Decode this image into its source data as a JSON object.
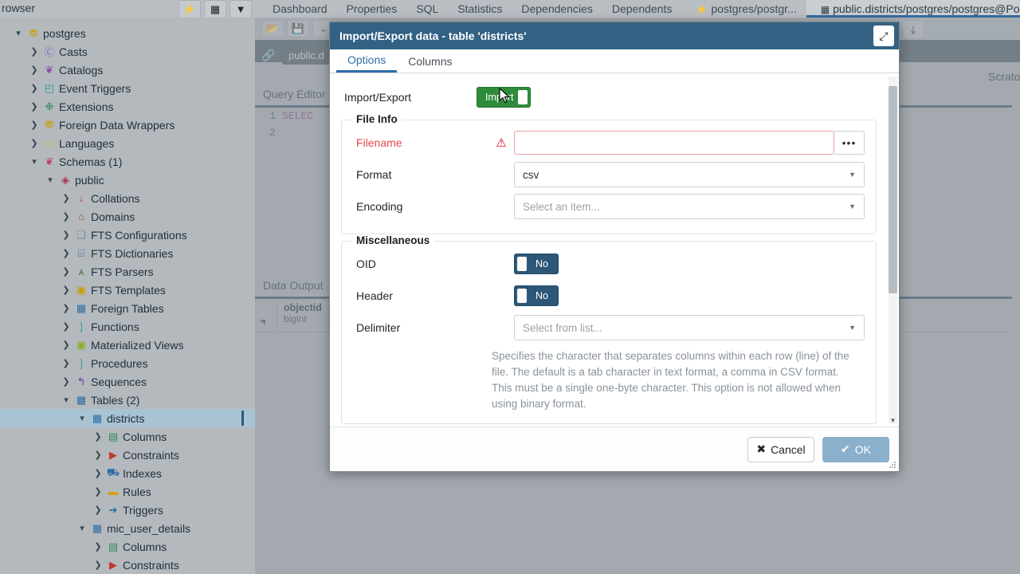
{
  "topbar": {
    "browser_label": "rowser",
    "toolbar_buttons": [
      {
        "name": "execute-query-button",
        "glyph": "⚡"
      },
      {
        "name": "view-data-button",
        "glyph": "▦"
      },
      {
        "name": "filter-button",
        "glyph": "▼"
      }
    ],
    "tabs": [
      {
        "label": "Dashboard",
        "active": false,
        "icon": ""
      },
      {
        "label": "Properties",
        "active": false,
        "icon": ""
      },
      {
        "label": "SQL",
        "active": false,
        "icon": ""
      },
      {
        "label": "Statistics",
        "active": false,
        "icon": ""
      },
      {
        "label": "Dependencies",
        "active": false,
        "icon": ""
      },
      {
        "label": "Dependents",
        "active": false,
        "icon": ""
      },
      {
        "label": "postgres/postgr...",
        "active": false,
        "icon": "⚡"
      },
      {
        "label": "public.districts/postgres/postgres@Postgr",
        "active": true,
        "icon": "▦"
      }
    ]
  },
  "sidebar": {
    "items": [
      {
        "label": "postgres",
        "depth": 1,
        "caret": "⌄",
        "icon": "⛃",
        "color": "#c7a008",
        "selected": false
      },
      {
        "label": "Casts",
        "depth": 2,
        "caret": "›",
        "icon": "Ⓒ",
        "color": "#7b6cc9",
        "selected": false
      },
      {
        "label": "Catalogs",
        "depth": 2,
        "caret": "›",
        "icon": "❦",
        "color": "#8e44ad",
        "selected": false
      },
      {
        "label": "Event Triggers",
        "depth": 2,
        "caret": "›",
        "icon": "◰",
        "color": "#1f9d9d",
        "selected": false
      },
      {
        "label": "Extensions",
        "depth": 2,
        "caret": "›",
        "icon": "❉",
        "color": "#2e8b57",
        "selected": false
      },
      {
        "label": "Foreign Data Wrappers",
        "depth": 2,
        "caret": "›",
        "icon": "⛃",
        "color": "#c7a008",
        "selected": false
      },
      {
        "label": "Languages",
        "depth": 2,
        "caret": "›",
        "icon": "⬭",
        "color": "#cfc200",
        "selected": false
      },
      {
        "label": "Schemas (1)",
        "depth": 2,
        "caret": "⌄",
        "icon": "❦",
        "color": "#c0396b",
        "selected": false
      },
      {
        "label": "public",
        "depth": 3,
        "caret": "⌄",
        "icon": "◈",
        "color": "#b03050",
        "selected": false
      },
      {
        "label": "Collations",
        "depth": 4,
        "caret": "›",
        "icon": "↓",
        "color": "#c0392b",
        "selected": false
      },
      {
        "label": "Domains",
        "depth": 4,
        "caret": "›",
        "icon": "⌂",
        "color": "#a0522d",
        "selected": false
      },
      {
        "label": "FTS Configurations",
        "depth": 4,
        "caret": "›",
        "icon": "❑",
        "color": "#7f8c8d",
        "selected": false
      },
      {
        "label": "FTS Dictionaries",
        "depth": 4,
        "caret": "›",
        "icon": "⌸",
        "color": "#2e6da4",
        "selected": false
      },
      {
        "label": "FTS Parsers",
        "depth": 4,
        "caret": "›",
        "icon": "ᴀ",
        "color": "#3c763d",
        "selected": false
      },
      {
        "label": "FTS Templates",
        "depth": 4,
        "caret": "›",
        "icon": "▣",
        "color": "#c7a008",
        "selected": false
      },
      {
        "label": "Foreign Tables",
        "depth": 4,
        "caret": "›",
        "icon": "▦",
        "color": "#2e6da4",
        "selected": false
      },
      {
        "label": "Functions",
        "depth": 4,
        "caret": "›",
        "icon": "❳",
        "color": "#1f9d9d",
        "selected": false
      },
      {
        "label": "Materialized Views",
        "depth": 4,
        "caret": "›",
        "icon": "▣",
        "color": "#8bae2c",
        "selected": false
      },
      {
        "label": "Procedures",
        "depth": 4,
        "caret": "›",
        "icon": "❳",
        "color": "#1f9d9d",
        "selected": false
      },
      {
        "label": "Sequences",
        "depth": 4,
        "caret": "›",
        "icon": "↰",
        "color": "#6a3ea1",
        "selected": false
      },
      {
        "label": "Tables (2)",
        "depth": 4,
        "caret": "⌄",
        "icon": "▦",
        "color": "#2e6da4",
        "selected": false
      },
      {
        "label": "districts",
        "depth": 5,
        "caret": "⌄",
        "icon": "▦",
        "color": "#2e6da4",
        "selected": true
      },
      {
        "label": "Columns",
        "depth": 6,
        "caret": "›",
        "icon": "▤",
        "color": "#2e8b57",
        "selected": false
      },
      {
        "label": "Constraints",
        "depth": 6,
        "caret": "›",
        "icon": "▶",
        "color": "#c0392b",
        "selected": false
      },
      {
        "label": "Indexes",
        "depth": 6,
        "caret": "›",
        "icon": "⛟",
        "color": "#2e6da4",
        "selected": false
      },
      {
        "label": "Rules",
        "depth": 6,
        "caret": "›",
        "icon": "▬",
        "color": "#d4a017",
        "selected": false
      },
      {
        "label": "Triggers",
        "depth": 6,
        "caret": "›",
        "icon": "➔",
        "color": "#1f6f9d",
        "selected": false
      },
      {
        "label": "mic_user_details",
        "depth": 5,
        "caret": "⌄",
        "icon": "▦",
        "color": "#2e6da4",
        "selected": false
      },
      {
        "label": "Columns",
        "depth": 6,
        "caret": "›",
        "icon": "▤",
        "color": "#2e8b57",
        "selected": false
      },
      {
        "label": "Constraints",
        "depth": 6,
        "caret": "›",
        "icon": "▶",
        "color": "#c0392b",
        "selected": false
      }
    ]
  },
  "query_panel": {
    "connection_tab": "public.d",
    "scratch_label": "Scrato",
    "editor_title": "Query Editor",
    "lines": [
      {
        "num": "1",
        "code": "SELEC"
      },
      {
        "num": "2",
        "code": ""
      }
    ],
    "data_output_title": "Data Output",
    "grid_columns": [
      {
        "name": "objectid",
        "type": "bigint"
      }
    ],
    "download_icon": "⤓"
  },
  "dialog": {
    "title": "Import/Export data - table 'districts'",
    "maximize_icon": "⤢",
    "tabs": [
      {
        "label": "Options",
        "active": true
      },
      {
        "label": "Columns",
        "active": false
      }
    ],
    "import_export": {
      "label": "Import/Export",
      "toggle_value": "Import"
    },
    "file_info": {
      "legend": "File Info",
      "filename": {
        "label": "Filename",
        "value": "",
        "placeholder": "",
        "browse_glyph": "•••",
        "warning_glyph": "⚠"
      },
      "format": {
        "label": "Format",
        "value": "csv"
      },
      "encoding": {
        "label": "Encoding",
        "value": "Select an item..."
      }
    },
    "miscellaneous": {
      "legend": "Miscellaneous",
      "oid": {
        "label": "OID",
        "value": "No"
      },
      "header": {
        "label": "Header",
        "value": "No"
      },
      "delimiter": {
        "label": "Delimiter",
        "value": "Select from list...",
        "help": "Specifies the character that separates columns within each row (line) of the file. The default is a tab character in text format, a comma in CSV format. This must be a single one-byte character. This option is not allowed when using binary format."
      }
    },
    "footer": {
      "cancel_label": "Cancel",
      "cancel_glyph": "✖",
      "ok_label": "OK",
      "ok_glyph": "✔"
    }
  },
  "colors": {
    "dialog_header": "#336184",
    "accent_blue": "#2f6ea5",
    "toggle_on_green": "#2e8b3a",
    "toggle_off_blue": "#2c5777",
    "error_red": "#e4484a",
    "ok_disabled": "#8bb0cc",
    "app_background": "#b4b9be",
    "dark_band": "#4a5a66"
  }
}
